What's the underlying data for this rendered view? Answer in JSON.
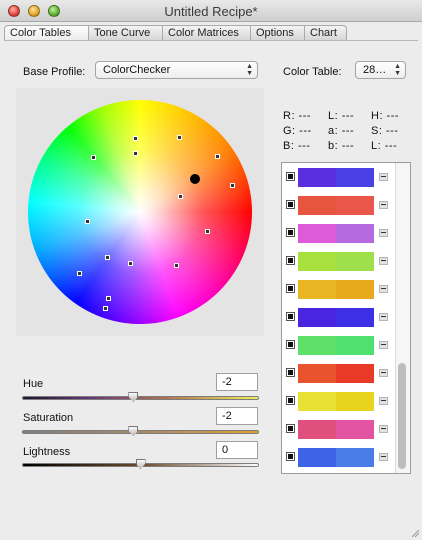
{
  "window": {
    "title": "Untitled Recipe*"
  },
  "tabs": [
    {
      "label": "Color Tables",
      "active": true
    },
    {
      "label": "Tone Curve",
      "active": false
    },
    {
      "label": "Color Matrices",
      "active": false
    },
    {
      "label": "Options",
      "active": false
    },
    {
      "label": "Chart",
      "active": false
    }
  ],
  "base_profile": {
    "label": "Base Profile:",
    "value": "ColorChecker"
  },
  "color_table": {
    "label": "Color Table:",
    "value": "28…"
  },
  "readouts": {
    "r": "R:  ---",
    "l1": "L:  ---",
    "h": "H:  ---",
    "g": "G:  ---",
    "a": "a:  ---",
    "s": "S:  ---",
    "b": "B:  ---",
    "b2": "b:  ---",
    "l2": "L:  ---"
  },
  "sliders": {
    "hue": {
      "label": "Hue",
      "value": "-2",
      "level": 0.47
    },
    "saturation": {
      "label": "Saturation",
      "value": "-2",
      "level": 0.47
    },
    "lightness": {
      "label": "Lightness",
      "value": "0",
      "level": 0.5
    }
  },
  "swatches": [
    [
      "#5a2fe0",
      "#4b3fe6"
    ],
    [
      "#e8553f",
      "#e8574a"
    ],
    [
      "#df5ad7",
      "#b66adf"
    ],
    [
      "#a8e03e",
      "#9de04a"
    ],
    [
      "#e8b622",
      "#e8a91c"
    ],
    [
      "#4b24e0",
      "#3c2fe6"
    ],
    [
      "#5fe06a",
      "#50e070"
    ],
    [
      "#e8522c",
      "#e83a26"
    ],
    [
      "#e8e033",
      "#e8d41e"
    ],
    [
      "#e0507e",
      "#e254a2"
    ],
    [
      "#3f63e6",
      "#4a7de8"
    ]
  ],
  "colors": {
    "accent": "#3875d7"
  }
}
